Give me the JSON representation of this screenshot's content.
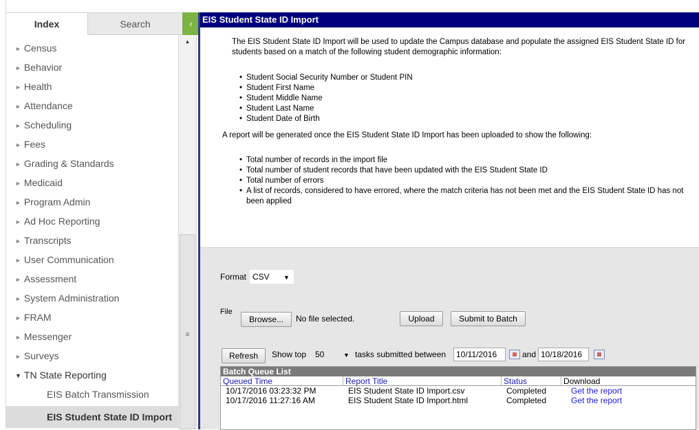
{
  "tabs": {
    "index": "Index",
    "search": "Search",
    "collapse_icon": "‹"
  },
  "nav": {
    "items": [
      {
        "label": "Census"
      },
      {
        "label": "Behavior"
      },
      {
        "label": "Health"
      },
      {
        "label": "Attendance"
      },
      {
        "label": "Scheduling"
      },
      {
        "label": "Fees"
      },
      {
        "label": "Grading & Standards"
      },
      {
        "label": "Medicaid"
      },
      {
        "label": "Program Admin"
      },
      {
        "label": "Ad Hoc Reporting"
      },
      {
        "label": "Transcripts"
      },
      {
        "label": "User Communication"
      },
      {
        "label": "Assessment"
      },
      {
        "label": "System Administration"
      },
      {
        "label": "FRAM"
      },
      {
        "label": "Messenger"
      },
      {
        "label": "Surveys"
      },
      {
        "label": "TN State Reporting"
      }
    ],
    "children": [
      {
        "label": "EIS Batch Transmission"
      },
      {
        "label": "EIS Student State ID Import"
      }
    ],
    "arrow_closed": "►",
    "arrow_open": "▼"
  },
  "page": {
    "title": "EIS Student State ID Import",
    "intro": "The EIS Student State ID Import will be used to update the Campus database and populate the assigned EIS Student State ID for students based on a match of the following student demographic information:",
    "match_fields": [
      "Student Social Security Number or Student PIN",
      "Student First Name",
      "Student Middle Name",
      "Student Last Name",
      "Student Date of Birth"
    ],
    "report_text": "A report will be generated once the EIS Student State ID Import has been uploaded to show the following:",
    "report_items": [
      "Total number of records in the import file",
      "Total number of student records that have been updated with the EIS Student State ID",
      "Total number of errors",
      "A list of records, considered to have errored, where the match criteria has not been met and the EIS Student State ID has not been applied"
    ]
  },
  "form": {
    "format_label": "Format",
    "format_value": "CSV",
    "file_label": "File",
    "browse_label": "Browse...",
    "file_status": "No file selected.",
    "upload_label": "Upload",
    "submit_batch_label": "Submit to Batch",
    "refresh_label": "Refresh",
    "show_top_label": "Show top",
    "show_top_value": "50",
    "tasks_between_label": "tasks submitted between",
    "date_from": "10/11/2016",
    "and_label": "and",
    "date_to": "10/18/2016"
  },
  "batch_queue": {
    "title": "Batch Queue List",
    "headers": [
      "Queued Time",
      "Report Title",
      "Status",
      "Download"
    ],
    "rows": [
      {
        "time": "10/17/2016 03:23:32 PM",
        "title": "EIS Student State ID Import.csv",
        "status": "Completed",
        "download": "Get the report"
      },
      {
        "time": "10/17/2016 11:27:16 AM",
        "title": "EIS Student State ID Import.html",
        "status": "Completed",
        "download": "Get the report"
      }
    ]
  }
}
